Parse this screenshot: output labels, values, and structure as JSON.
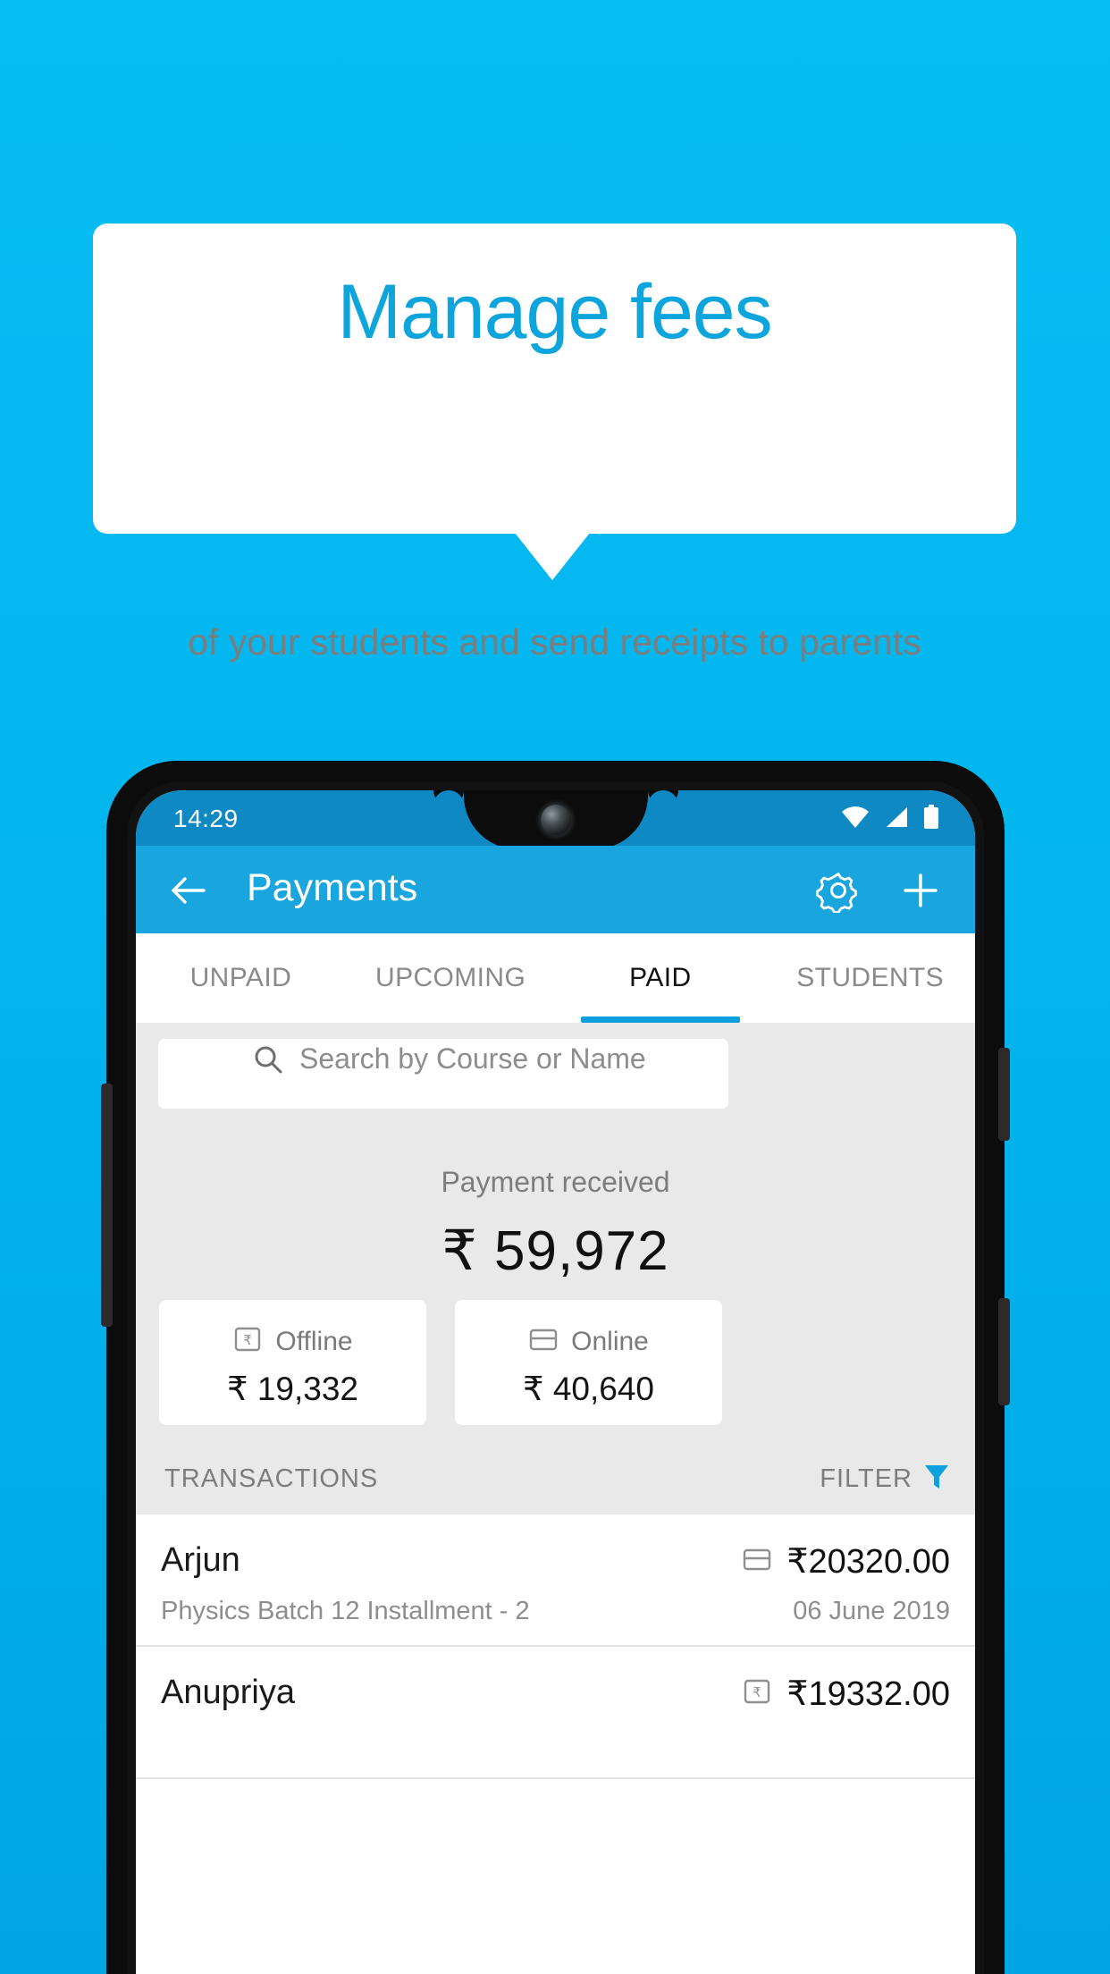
{
  "promo": {
    "headline": "Manage fees",
    "subheadline": "of your students and send receipts to parents",
    "accent_color": "#0EA5DD",
    "background_color": "#06BEF2"
  },
  "status_bar": {
    "time": "14:29",
    "icons": [
      "wifi-icon",
      "cellular-signal-icon",
      "battery-full-icon"
    ]
  },
  "app_bar": {
    "title": "Payments",
    "back_icon": "back-arrow-icon",
    "settings_icon": "gear-icon",
    "add_icon": "plus-icon",
    "color": "#19A6DE"
  },
  "tabs": [
    {
      "label": "UNPAID",
      "active": false
    },
    {
      "label": "UPCOMING",
      "active": false
    },
    {
      "label": "PAID",
      "active": true
    },
    {
      "label": "STUDENTS",
      "active": false
    }
  ],
  "search": {
    "placeholder": "Search by Course or Name",
    "icon": "search-icon"
  },
  "summary": {
    "label": "Payment received",
    "amount": "₹ 59,972",
    "cards": [
      {
        "label": "Offline",
        "amount": "₹ 19,332",
        "icon": "rupee-note-icon"
      },
      {
        "label": "Online",
        "amount": "₹ 40,640",
        "icon": "credit-card-icon"
      }
    ]
  },
  "transactions_section": {
    "title": "TRANSACTIONS",
    "filter_label": "FILTER",
    "filter_icon": "funnel-icon",
    "filter_icon_color": "#0CA2DE"
  },
  "transactions": [
    {
      "name": "Arjun",
      "amount": "₹20320.00",
      "method_icon": "credit-card-icon",
      "description": "Physics Batch 12 Installment - 2",
      "date": "06 June 2019"
    },
    {
      "name": "Anupriya",
      "amount": "₹19332.00",
      "method_icon": "rupee-note-icon",
      "description": "",
      "date": ""
    }
  ]
}
